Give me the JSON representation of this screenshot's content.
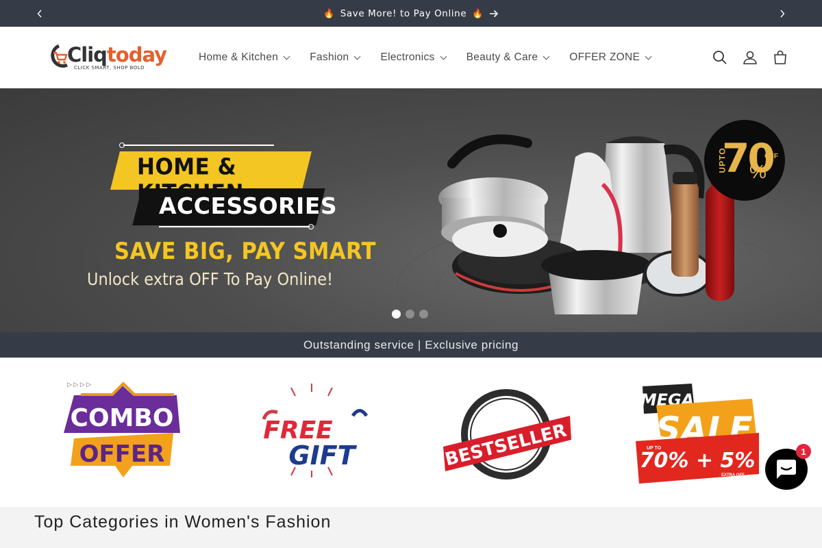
{
  "announcement": {
    "text": "Save More! to Pay Online",
    "fire_icon": "fire-icon"
  },
  "header": {
    "logo_text_part1": "Cliq",
    "logo_text_part2": "today",
    "logo_tagline": "CLICK SMART, SHOP BOLD",
    "nav": [
      {
        "label": "Home & Kitchen"
      },
      {
        "label": "Fashion"
      },
      {
        "label": "Electronics"
      },
      {
        "label": "Beauty & Care"
      },
      {
        "label": "OFFER ZONE"
      }
    ]
  },
  "hero": {
    "title_line1": "HOME & KITCHEN",
    "title_line2": "ACCESSORIES",
    "headline": "SAVE BIG, PAY SMART",
    "subline": "Unlock extra OFF To Pay Online!",
    "badge_upto": "UPTO",
    "badge_value": "70",
    "badge_percent": "%",
    "badge_off": "OFF",
    "slides": 3,
    "active_slide": 1
  },
  "strip": {
    "text": "Outstanding service | Exclusive pricing"
  },
  "promos": [
    {
      "line1": "COMBO",
      "line2": "OFFER"
    },
    {
      "line1": "FREE",
      "line2": "GIFT"
    },
    {
      "line1": "BESTSELLER"
    },
    {
      "line1": "MEGA",
      "line2": "SALE",
      "line3": "UP TO",
      "line4": "70% + 5%",
      "line5": "EXTRA OFF"
    }
  ],
  "section": {
    "title": "Top Categories in Women's Fashion"
  },
  "chat": {
    "badge_count": "1"
  },
  "colors": {
    "dark_bar": "#363c47",
    "brand_orange": "#e4602c",
    "hero_yellow": "#f3c623"
  }
}
